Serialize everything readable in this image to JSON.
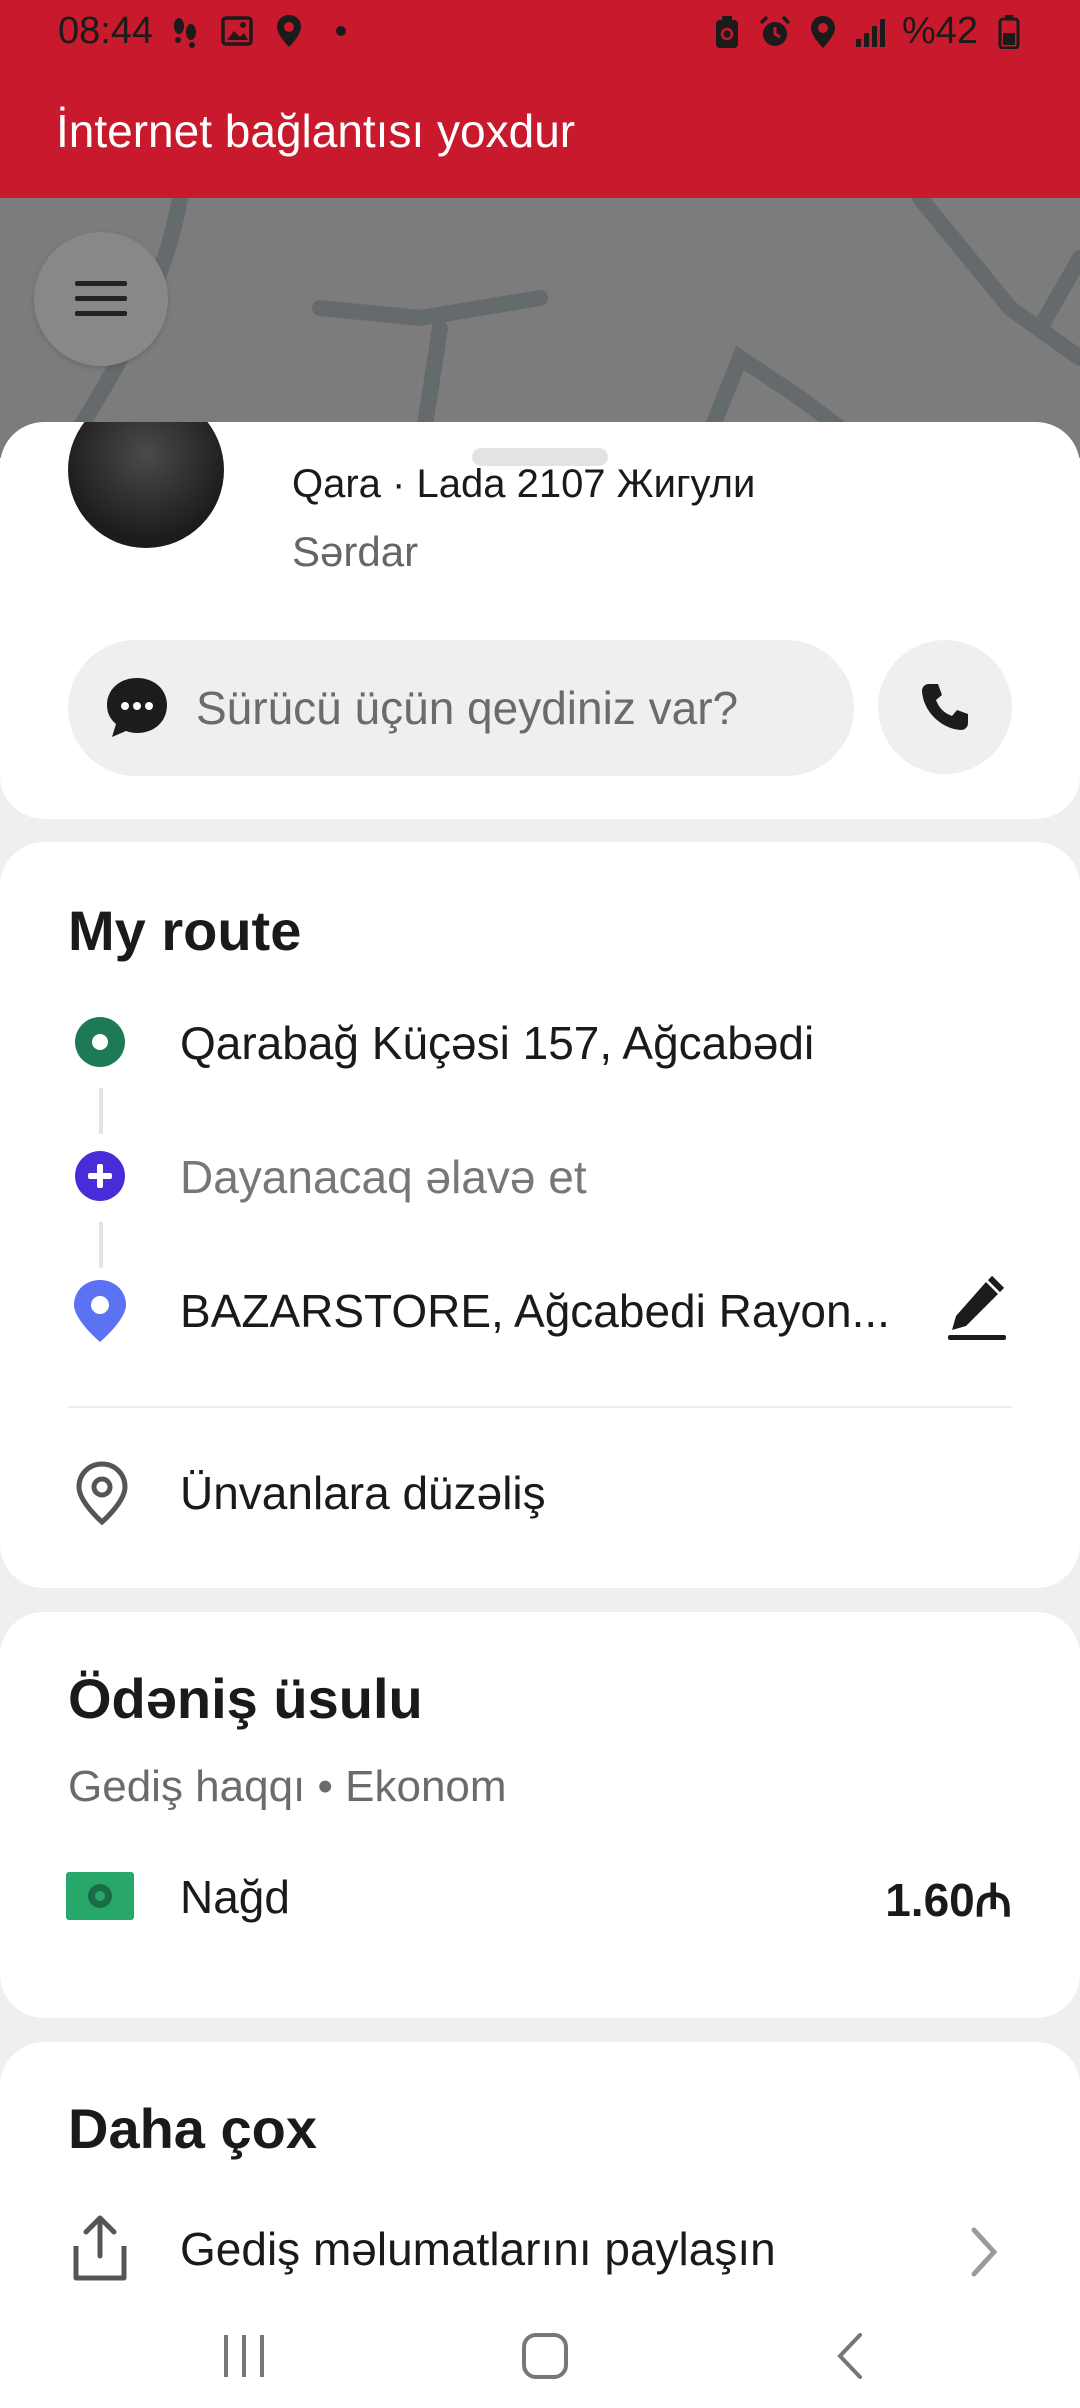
{
  "status_bar": {
    "time": "08:44",
    "battery": "%42",
    "left_icons": [
      "footsteps-icon",
      "image-icon",
      "location-pin-icon",
      "dot-icon"
    ],
    "right_icons": [
      "battery-saver-icon",
      "alarm-icon",
      "location-icon",
      "signal-icon",
      "battery-icon"
    ]
  },
  "banner": {
    "text": "İnternet bağlantısı yoxdur",
    "color": "#c81a2c"
  },
  "driver": {
    "car": "Qara · Lada 2107 Жигули",
    "name": "Sərdar",
    "note_placeholder": "Sürücü üçün qeydiniz var?"
  },
  "route": {
    "title": "My route",
    "pickup": "Qarabağ Küçəsi 157, Ağcabədi",
    "add_stop": "Dayanacaq əlavə et",
    "destination": "BAZARSTORE, Ağcabedi Rayon...",
    "edit_addresses": "Ünvanlara düzəliş",
    "colors": {
      "pickup": "#1e7a55",
      "add_stop": "#4a2bd8",
      "destination": "#5b72f2"
    }
  },
  "payment": {
    "title": "Ödəniş üsulu",
    "subtitle": "Gediş haqqı • Ekonom",
    "method": "Nağd",
    "price": "1.60₼"
  },
  "more": {
    "title": "Daha çox",
    "share": "Gediş məlumatlarını paylaşın"
  }
}
